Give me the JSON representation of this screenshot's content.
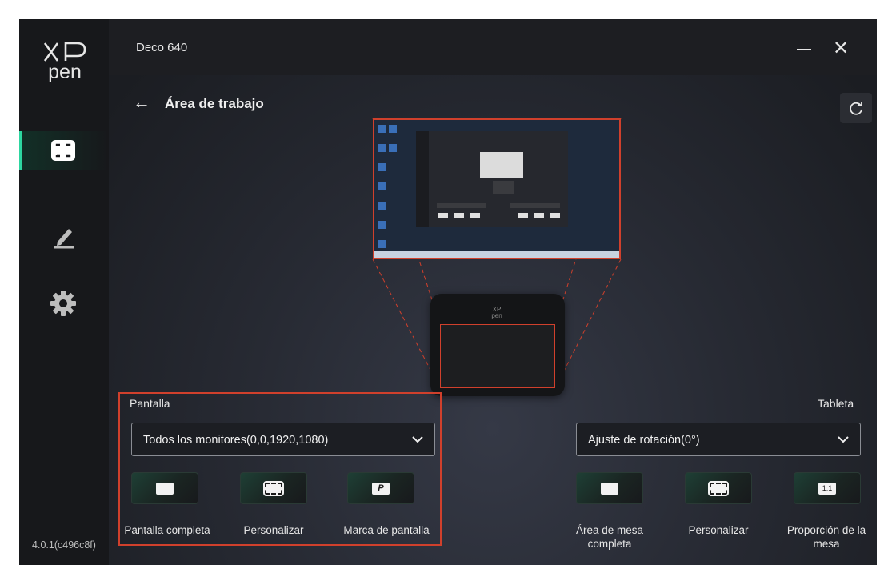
{
  "app": {
    "logo_top": "XP",
    "logo_bottom": "pen",
    "device_name": "Deco 640",
    "version": "4.0.1(c496c8f)"
  },
  "sidebar": {
    "items": [
      {
        "icon": "work-area-icon",
        "active": true
      },
      {
        "icon": "pen-icon",
        "active": false
      },
      {
        "icon": "settings-gear-icon",
        "active": false
      }
    ]
  },
  "header": {
    "back_arrow": "←",
    "title": "Área de trabajo",
    "refresh_icon": "refresh-icon"
  },
  "window_controls": {
    "minimize": "minimize-icon",
    "close": "✕"
  },
  "preview": {
    "tablet_logo_top": "XP",
    "tablet_logo_bottom": "pen"
  },
  "screen": {
    "label": "Pantalla",
    "monitor_selected": "Todos los monitores(0,0,1920,1080)",
    "options": [
      {
        "label": "Pantalla completa",
        "glyph": "full-screen-icon"
      },
      {
        "label": "Personalizar",
        "glyph": "custom-area-icon"
      },
      {
        "label": "Marca de pantalla",
        "glyph": "P"
      }
    ]
  },
  "tablet": {
    "label": "Tableta",
    "rotation_selected": "Ajuste de rotación(0°)",
    "options": [
      {
        "label": "Área de mesa completa",
        "glyph": "full-tablet-icon"
      },
      {
        "label": "Personalizar",
        "glyph": "custom-tablet-icon"
      },
      {
        "label": "Proporción de la mesa",
        "glyph": "1:1"
      }
    ]
  },
  "colors": {
    "accent": "#2dd6a0",
    "highlight": "#d0402c",
    "background": "#1b1d22"
  }
}
